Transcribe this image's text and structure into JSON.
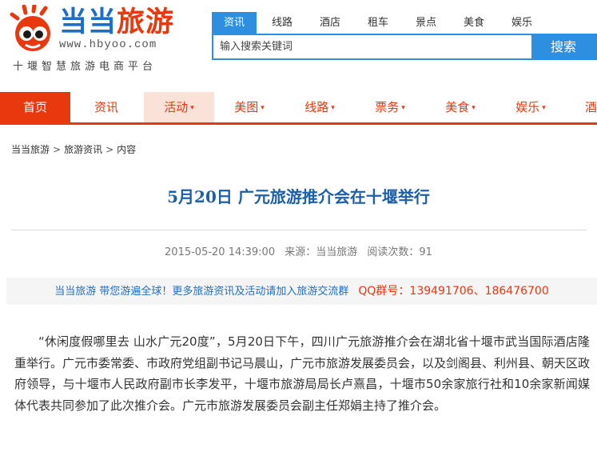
{
  "site": {
    "logo_title_a": "当当",
    "logo_title_b": "旅游",
    "logo_url": "www.hbyoo.com",
    "slogan": "十堰智慧旅游电商平台"
  },
  "search": {
    "tabs": [
      "资讯",
      "线路",
      "酒店",
      "租车",
      "景点",
      "美食",
      "娱乐"
    ],
    "active_tab": "资讯",
    "placeholder": "输入搜索关键词",
    "button_label": "搜索"
  },
  "nav": {
    "items": [
      {
        "label": "首页",
        "caret": false
      },
      {
        "label": "资讯",
        "caret": false
      },
      {
        "label": "活动",
        "caret": true
      },
      {
        "label": "美图",
        "caret": true
      },
      {
        "label": "线路",
        "caret": true
      },
      {
        "label": "票务",
        "caret": true
      },
      {
        "label": "美食",
        "caret": true
      },
      {
        "label": "娱乐",
        "caret": true
      },
      {
        "label": "酒",
        "caret": false
      }
    ],
    "caret_glyph": "▾"
  },
  "breadcrumb": {
    "items": [
      "当当旅游",
      "旅游资讯",
      "内容"
    ],
    "separator": ">"
  },
  "article": {
    "title": "5月20日 广元旅游推介会在十堰举行",
    "date": "2015-05-20 14:39:00",
    "source": "来源：当当旅游",
    "views": "阅读次数：91",
    "body": "“休闲度假哪里去 山水广元20度”，5月20日下午，四川广元旅游推介会在湖北省十堰市武当国际酒店隆重举行。广元市委常委、市政府党组副书记马晨山，广元市旅游发展委员会，以及剑阁县、利州县、朝天区政府领导，与十堰市人民政府副市长李发平，十堰市旅游局局长卢熹昌，十堰市50余家旅行社和10余家新闻媒体代表共同参加了此次推介会。广元市旅游发展委员会副主任郑娟主持了推介会。"
  },
  "promo": {
    "text": "当当旅游 带您游遍全球！更多旅游资讯及活动请加入旅游交流群",
    "qq": "QQ群号：139491706、186476700"
  },
  "colors": {
    "brand_blue": "#1d6fc4",
    "brand_red": "#e8380d",
    "search_blue": "#2e8ee0"
  }
}
